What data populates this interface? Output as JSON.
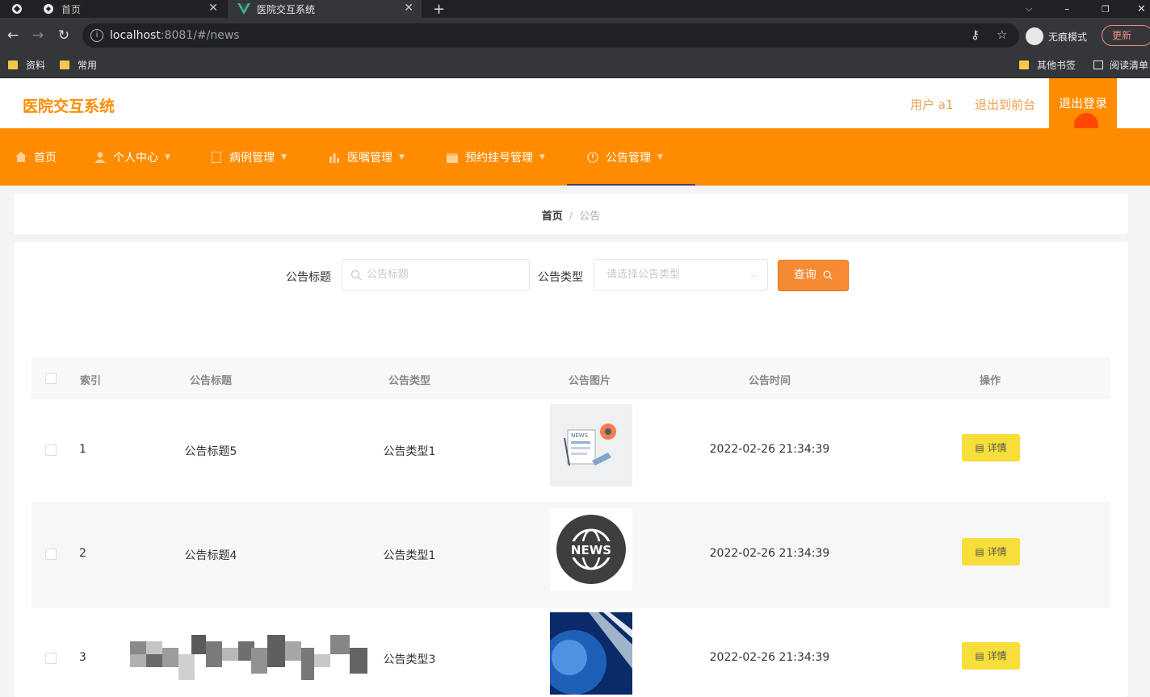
{
  "browser": {
    "tabs": [
      {
        "title": "首页",
        "active": false
      },
      {
        "title": "医院交互系统",
        "active": true
      }
    ],
    "url_host": "localhost",
    "url_rest": ":8081/#/news",
    "incognito_label": "无痕模式",
    "update_label": "更新",
    "bookmarks": [
      "资料",
      "常用"
    ],
    "bookmarks_right": [
      "其他书签",
      "阅读清单"
    ]
  },
  "header": {
    "logo": "医院交互系统",
    "user": "用户 a1",
    "back_front": "退出到前台",
    "logout": "退出登录"
  },
  "nav": [
    {
      "label": "首页",
      "icon": "home-icon",
      "chev": false
    },
    {
      "label": "个人中心",
      "icon": "user-icon",
      "chev": true
    },
    {
      "label": "病例管理",
      "icon": "document-icon",
      "chev": true
    },
    {
      "label": "医嘱管理",
      "icon": "bar-chart-icon",
      "chev": true
    },
    {
      "label": "预约挂号管理",
      "icon": "calendar-icon",
      "chev": true
    },
    {
      "label": "公告管理",
      "icon": "notice-icon",
      "chev": true
    }
  ],
  "breadcrumb": {
    "home": "首页",
    "sep": "/",
    "current": "公告"
  },
  "search": {
    "title_label": "公告标题",
    "title_placeholder": "公告标题",
    "type_label": "公告类型",
    "type_placeholder": "请选择公告类型",
    "query_label": "查询"
  },
  "table": {
    "headers": [
      "索引",
      "公告标题",
      "公告类型",
      "公告图片",
      "公告时间",
      "操作"
    ],
    "rows": [
      {
        "index": "1",
        "title": "公告标题5",
        "type": "公告类型1",
        "time": "2022-02-26 21:34:39",
        "action": "详情"
      },
      {
        "index": "2",
        "title": "公告标题4",
        "type": "公告类型1",
        "time": "2022-02-26 21:34:39",
        "action": "详情"
      },
      {
        "index": "3",
        "title": "",
        "type": "公告类型3",
        "time": "2022-02-26 21:34:39",
        "action": "详情"
      }
    ],
    "news_badge": "NEWS"
  },
  "colors": {
    "brand": "#ff8c00",
    "query": "#f58a33",
    "detail": "#f7de3a"
  }
}
